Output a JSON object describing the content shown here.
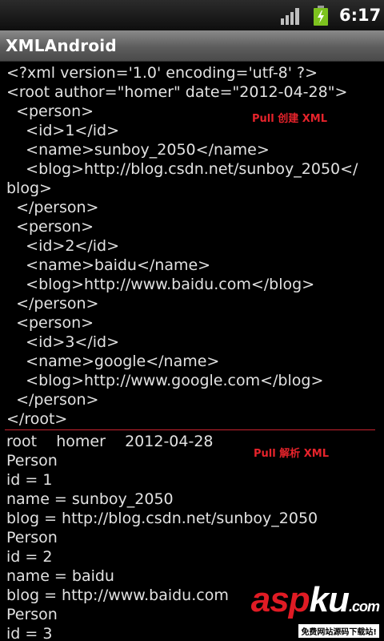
{
  "status_bar": {
    "time": "6:17"
  },
  "app": {
    "title": "XMLAndroid"
  },
  "xml_output": [
    "<?xml version='1.0' encoding='utf-8' ?>",
    "<root author=\"homer\" date=\"2012-04-28\">",
    "  <person>",
    "    <id>1</id>",
    "    <name>sunboy_2050</name>",
    "    <blog>http://blog.csdn.net/sunboy_2050</",
    "blog>",
    "  </person>",
    "  <person>",
    "    <id>2</id>",
    "    <name>baidu</name>",
    "    <blog>http://www.baidu.com</blog>",
    "  </person>",
    "  <person>",
    "    <id>3</id>",
    "    <name>google</name>",
    "    <blog>http://www.google.com</blog>",
    "  </person>",
    "</root>"
  ],
  "parse_output": [
    "root    homer    2012-04-28",
    "Person",
    "id = 1",
    "name = sunboy_2050",
    "blog = http://blog.csdn.net/sunboy_2050",
    "Person",
    "id = 2",
    "name = baidu",
    "blog = http://www.baidu.com",
    "Person",
    "id = 3"
  ],
  "annotations": {
    "create": "Pull 创建 XML",
    "parse": "Pull 解析 XML"
  },
  "watermark": {
    "part1": "asp",
    "part2": "ku",
    "suffix": ".com",
    "tagline": "免费网站源码下载站!"
  },
  "colors": {
    "annotation": "#e6232b",
    "divider": "#c8232f",
    "battery": "#7dc21e"
  },
  "icons": {
    "signal": "signal-strength-icon",
    "battery": "battery-charging-icon"
  }
}
